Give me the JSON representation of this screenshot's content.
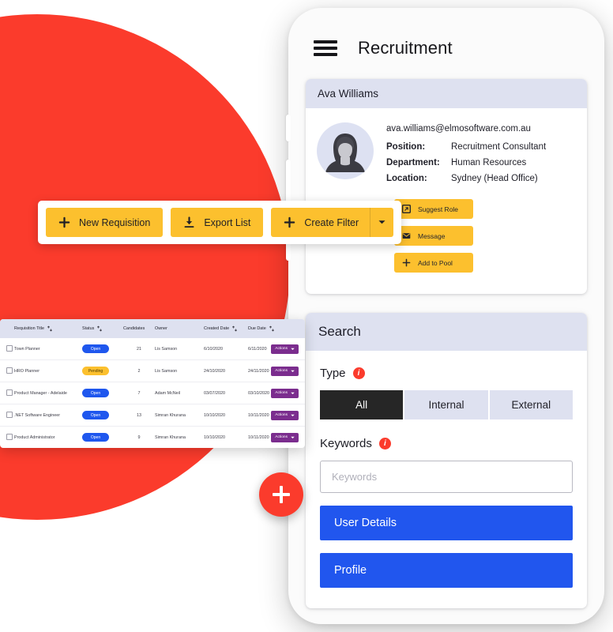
{
  "app": {
    "title": "Recruitment",
    "menu_icon": "hamburger-menu-icon"
  },
  "profile": {
    "header": "Ava Williams",
    "avatar_icon": "user-avatar-photo",
    "email": "ava.williams@elmosoftware.com.au",
    "fields": [
      {
        "label": "Position:",
        "value": "Recruitment Consultant"
      },
      {
        "label": "Department:",
        "value": "Human Resources"
      },
      {
        "label": "Location:",
        "value": "Sydney (Head Office)"
      }
    ],
    "actions": [
      {
        "label": "Suggest Role",
        "icon": "external-link-icon"
      },
      {
        "label": "Message",
        "icon": "envelope-icon"
      },
      {
        "label": "Add to Pool",
        "icon": "plus-icon"
      }
    ]
  },
  "search": {
    "header": "Search",
    "type_label": "Type",
    "type_info_icon": "info-icon",
    "type_options": [
      "All",
      "Internal",
      "External"
    ],
    "type_selected": "All",
    "keywords_label": "Keywords",
    "keywords_info_icon": "info-icon",
    "keywords_placeholder": "Keywords",
    "keywords_value": "",
    "buttons": [
      {
        "label": "User Details"
      },
      {
        "label": "Profile"
      }
    ]
  },
  "toolbar": {
    "new_requisition": "New Requisition",
    "new_requisition_icon": "plus-icon",
    "export_list": "Export List",
    "export_list_icon": "download-icon",
    "create_filter": "Create Filter",
    "create_filter_icon": "plus-icon",
    "dropdown_icon": "chevron-down-icon"
  },
  "table": {
    "columns": [
      {
        "label": "Requisition Title",
        "sortable": true
      },
      {
        "label": "Status",
        "sortable": true
      },
      {
        "label": "Candidates",
        "sortable": false
      },
      {
        "label": "Owner",
        "sortable": false
      },
      {
        "label": "Created Date",
        "sortable": true
      },
      {
        "label": "Due Date",
        "sortable": true
      }
    ],
    "action_label": "Actions",
    "rows": [
      {
        "title": "Town Planner",
        "status": "Open",
        "candidates": "21",
        "owner": "Lis Samson",
        "created": "6/10/2020",
        "due": "6/11/2020"
      },
      {
        "title": "HRO Planner",
        "status": "Pending",
        "candidates": "2",
        "owner": "Lis Samson",
        "created": "24/10/2020",
        "due": "24/11/2020"
      },
      {
        "title": "Product Manager - Adelaide",
        "status": "Open",
        "candidates": "7",
        "owner": "Adam McNeil",
        "created": "03/07/2020",
        "due": "03/10/2020"
      },
      {
        "title": ".NET Software Engineer",
        "status": "Open",
        "candidates": "13",
        "owner": "Simran Khurana",
        "created": "10/10/2020",
        "due": "10/11/2020"
      },
      {
        "title": "Product Administrator",
        "status": "Open",
        "candidates": "9",
        "owner": "Simran Khurana",
        "created": "10/10/2020",
        "due": "10/11/2020"
      }
    ]
  },
  "fab": {
    "icon": "plus-icon"
  },
  "colors": {
    "red": "#FB3B2C",
    "yellow": "#FCC02E",
    "blue": "#2156EE",
    "pill_blue": "#1F57EE",
    "purple": "#7B2D8E",
    "header_lavender": "#DEE1F0",
    "dark": "#262626"
  }
}
